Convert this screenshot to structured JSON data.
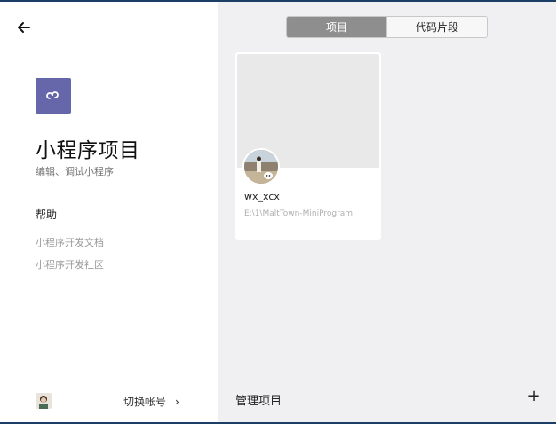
{
  "left": {
    "back_icon": "arrow-left-icon",
    "app_icon": "miniprogram-logo-icon",
    "title": "小程序项目",
    "subtitle": "编辑、调试小程序",
    "help_title": "帮助",
    "help_links": [
      "小程序开发文档",
      "小程序开发社区"
    ],
    "switch_account": "切换帐号",
    "switch_chevron": "›"
  },
  "right": {
    "tabs": [
      {
        "label": "项目",
        "active": true
      },
      {
        "label": "代码片段",
        "active": false
      }
    ],
    "project": {
      "name": "wx_xcx",
      "path": "E:\\1\\MaltTown-MiniProgram"
    },
    "manage_label": "管理项目",
    "add_icon": "plus-icon",
    "add_symbol": "+"
  },
  "colors": {
    "logo_bg": "#6667ab",
    "right_bg": "#f0f0f2",
    "tab_active": "#8e8e8e",
    "border_accent": "#1b3f66"
  }
}
